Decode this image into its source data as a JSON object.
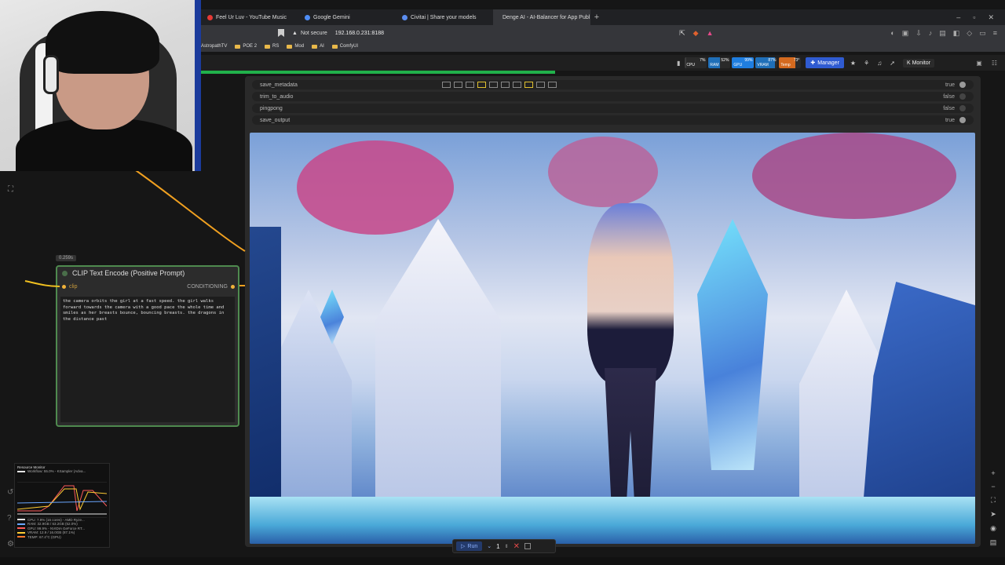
{
  "browser": {
    "tabs": [
      {
        "label": "Feel Ur Luv - YouTube Music",
        "color": "#e53935"
      },
      {
        "label": "Google Gemini",
        "color": "#4e8df5"
      },
      {
        "label": "Civitai | Share your models",
        "color": "#5b8def"
      },
      {
        "label": "Denge AI - AI-Balancer for App Publ",
        "color": "#cfcfcf"
      }
    ],
    "new_tab": "+",
    "address": {
      "security": "Not secure",
      "url": "192.168.0.231:8188"
    },
    "bookmarks": [
      "AstropathTV",
      "POE 2",
      "RS",
      "Mod",
      "AI",
      "ComfyUI"
    ]
  },
  "comfy": {
    "monitors": [
      {
        "label": "CPU",
        "value": "7%",
        "color": "#3b3b3b"
      },
      {
        "label": "RAM",
        "value": "52%",
        "color": "#1f6fb8"
      },
      {
        "label": "GPU",
        "value": "99%",
        "color": "#1f7ee0"
      },
      {
        "label": "VRAM",
        "value": "87%",
        "color": "#1f6fb8"
      },
      {
        "label": "Temp",
        "value": "73°",
        "color": "#d46a1f"
      }
    ],
    "manager_label": "Manager",
    "k_monitor_label": "K Monitor",
    "progress_fraction": 0.44
  },
  "video_node": {
    "widgets": [
      {
        "name": "save_metadata",
        "value": "true",
        "on": true
      },
      {
        "name": "trim_to_audio",
        "value": "false",
        "on": false
      },
      {
        "name": "pingpong",
        "value": "false",
        "on": false
      },
      {
        "name": "save_output",
        "value": "true",
        "on": true
      }
    ]
  },
  "clip_node": {
    "timing": "0.259s",
    "title": "CLIP Text Encode (Positive Prompt)",
    "input": "clip",
    "output": "CONDITIONING",
    "prompt": "the camera orbits the girl at a fast speed. the girl walks forward towards the camera with a good pace the whole time and smiles as her breasts bounce, bouncing breasts. the dragons in the distance past"
  },
  "run_bar": {
    "run_label": "Run",
    "batch_count": "1"
  },
  "resource_monitor": {
    "title": "Resource Monitor",
    "workflow": "Workflow: 55.0% - KSampler (Adva...",
    "rows": [
      {
        "text": "CPU: 7.9% (16 cores) - AMD Ryze...",
        "color": "#e5e5e5"
      },
      {
        "text": "RAM: 32.9GB / 63.2GB (52.0%)",
        "color": "#6aa7ff"
      },
      {
        "text": "GPU: 99.9% - NVIDIA GeForce RT...",
        "color": "#ff5a5a"
      },
      {
        "text": "VRAM: 12.9 / 16.0GB (87.1%)",
        "color": "#ffcc33"
      },
      {
        "text": "TEMP: 67.4°C (GPU)",
        "color": "#ff7a2a"
      }
    ]
  }
}
